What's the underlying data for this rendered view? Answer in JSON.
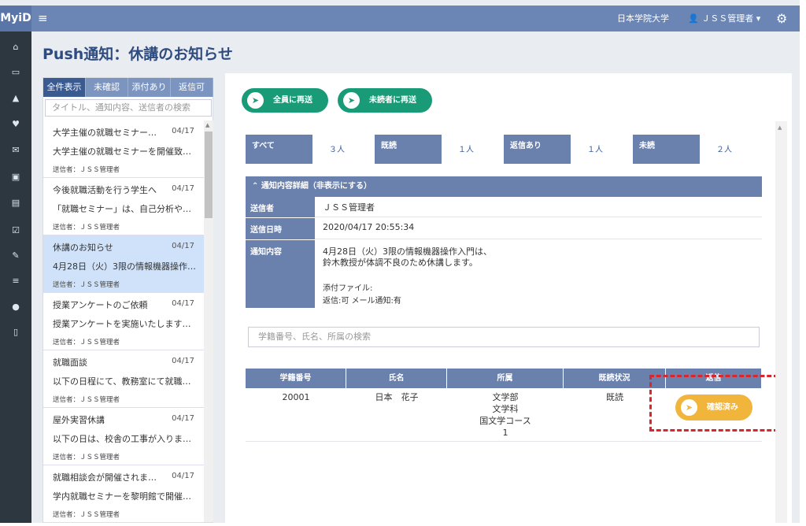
{
  "topbar": {
    "logo": "MyiD",
    "menu_icon": "≡",
    "university": "日本学院大学",
    "user": "ＪＳＳ管理者 ▾",
    "settings_icon": "⚙"
  },
  "sidebar": {
    "icons": [
      "home-icon",
      "id-card-icon",
      "bell-icon",
      "heart-icon",
      "mail-icon",
      "presentation-icon",
      "book-icon",
      "calendar-check-icon",
      "pencil-icon",
      "database-icon",
      "user-settings-icon",
      "mobile-icon"
    ],
    "glyphs": [
      "⌂",
      "▭",
      "▲",
      "♥",
      "✉",
      "▣",
      "▤",
      "☑",
      "✎",
      "≡",
      "●",
      "▯"
    ]
  },
  "page_title": "Push通知：休講のお知らせ",
  "filters": {
    "tabs": [
      "全件表示",
      "未確認",
      "添付あり",
      "返信可"
    ],
    "active": 0,
    "search_placeholder": "タイトル、通知内容、送信者の検索"
  },
  "messages": [
    {
      "title": "大学主催の就職セミナー…",
      "date": "04/17",
      "body": "大学主催の就職セミナーを開催致…",
      "sender": "送信者：ＪＳＳ管理者"
    },
    {
      "title": "今後就職活動を行う学生へ",
      "date": "04/17",
      "body": "「就職セミナー」は、自己分析や…",
      "sender": "送信者：ＪＳＳ管理者"
    },
    {
      "title": "休講のお知らせ",
      "date": "04/17",
      "body": "4月28日（火）3限の情報機器操作…",
      "sender": "送信者：ＪＳＳ管理者"
    },
    {
      "title": "授業アンケートのご依頼",
      "date": "04/17",
      "body": "授業アンケートを実施いたします…",
      "sender": "送信者：ＪＳＳ管理者"
    },
    {
      "title": "就職面談",
      "date": "04/17",
      "body": "以下の日程にて、教務室にて就職…",
      "sender": "送信者：ＪＳＳ管理者"
    },
    {
      "title": "屋外実習休講",
      "date": "04/17",
      "body": "以下の日は、校舎の工事が入りま…",
      "sender": "送信者：ＪＳＳ管理者"
    },
    {
      "title": "就職相談会が開催されま…",
      "date": "04/17",
      "body": "学内就職セミナーを黎明館で開催…",
      "sender": "送信者：ＪＳＳ管理者"
    }
  ],
  "selected_message": 2,
  "actions": {
    "resend_all": "全員に再送",
    "resend_unread": "未読者に再送"
  },
  "stats": [
    {
      "label": "すべて",
      "value": "３人"
    },
    {
      "label": "既読",
      "value": "１人"
    },
    {
      "label": "返信あり",
      "value": "１人"
    },
    {
      "label": "未読",
      "value": "２人"
    }
  ],
  "detail": {
    "header": "通知内容詳細（非表示にする）",
    "sender_label": "送信者",
    "sender": "ＪＳＳ管理者",
    "datetime_label": "送信日時",
    "datetime": "2020/04/17 20:55:34",
    "content_label": "通知内容",
    "content_line1": "4月28日（火）3限の情報機器操作入門は、",
    "content_line2": "鈴木教授が体調不良のため休講します。",
    "attachment": "添付ファイル:",
    "reply": "返信:可 メール通知:有"
  },
  "student_search_placeholder": "学籍番号、氏名、所属の検索",
  "table": {
    "headers": [
      "学籍番号",
      "氏名",
      "所属",
      "既読状況",
      "返信"
    ],
    "rows": [
      {
        "id": "20001",
        "name": "日本　花子",
        "affiliation": [
          "文学部",
          "文学科",
          "国文学コース",
          "1"
        ],
        "status": "既読",
        "reply_button": "確認済み"
      }
    ]
  }
}
